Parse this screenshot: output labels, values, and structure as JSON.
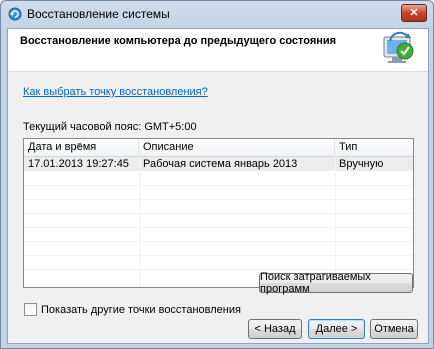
{
  "window": {
    "title": "Восстановление системы",
    "close_glyph": "✕"
  },
  "header": {
    "title": "Восстановление компьютера до предыдущего состояния",
    "icon": "system-restore-icon"
  },
  "help_link": "Как выбрать точку восстановления?",
  "timezone_text": "Текущий часовой пояс: GMT+5:00",
  "table": {
    "columns": [
      "Дата и время",
      "Описание",
      "Тип"
    ],
    "rows": [
      {
        "datetime": "17.01.2013 19:27:45",
        "description": "Рабочая система январь 2013",
        "type": "Вручную"
      }
    ]
  },
  "show_more_label": "Показать другие точки восстановления",
  "show_more_checked": false,
  "buttons": {
    "scan_programs": "Поиск затрагиваемых программ",
    "back": "< Назад",
    "next": "Далее >",
    "cancel": "Отмена"
  }
}
